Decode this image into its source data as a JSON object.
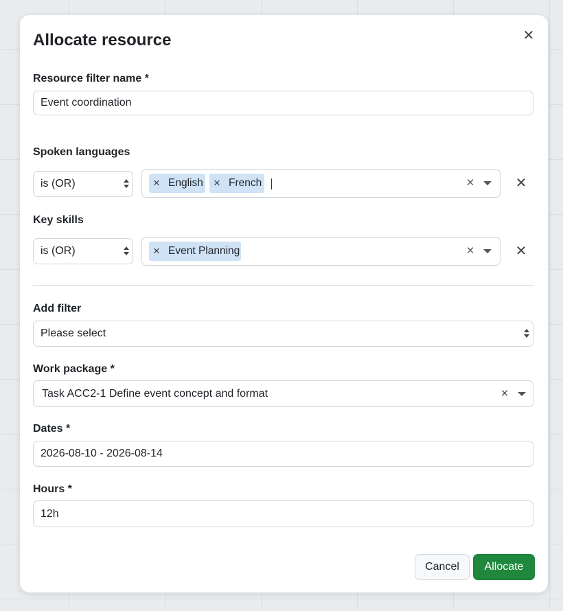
{
  "dialog": {
    "title": "Allocate resource",
    "close_icon": "close-icon",
    "fields": {
      "resource_filter_name": {
        "label": "Resource filter name *",
        "value": "Event coordination"
      },
      "spoken_languages": {
        "label": "Spoken languages",
        "operator": "is (OR)",
        "values": [
          "English",
          "French"
        ]
      },
      "key_skills": {
        "label": "Key skills",
        "operator": "is (OR)",
        "values": [
          "Event Planning"
        ]
      },
      "add_filter": {
        "label": "Add filter",
        "value": "Please select"
      },
      "work_package": {
        "label": "Work package *",
        "value": "Task ACC2-1 Define event concept and format"
      },
      "dates": {
        "label": "Dates *",
        "value": "2026-08-10 - 2026-08-14"
      },
      "hours": {
        "label": "Hours *",
        "value": "12h"
      }
    },
    "buttons": {
      "cancel": "Cancel",
      "allocate": "Allocate"
    },
    "colors": {
      "primary": "#1f883d",
      "chip": "#cfe2f6"
    }
  }
}
